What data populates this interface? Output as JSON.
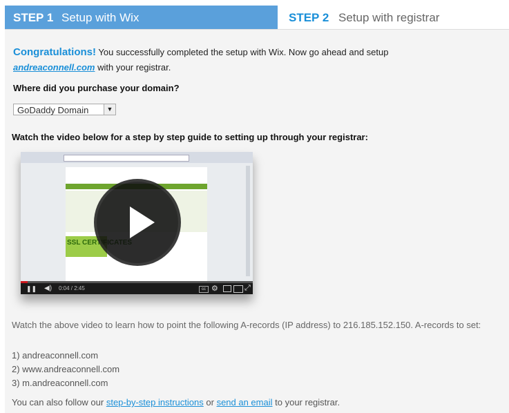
{
  "steps": [
    {
      "number": "STEP 1",
      "label": "Setup with Wix"
    },
    {
      "number": "STEP 2",
      "label": "Setup with registrar"
    }
  ],
  "congrats": {
    "heading": "Congratulations!",
    "text_before": "You successfully completed the setup with Wix. Now go ahead and setup",
    "domain": "andreaconnell.com",
    "text_after": "with your registrar."
  },
  "question": "Where did you purchase your domain?",
  "registrar_select": {
    "value": "GoDaddy Domain"
  },
  "watch_text": "Watch the video below for a step by step guide to setting up through your registrar:",
  "video": {
    "time": "0:04 / 2:45",
    "progress": 0.03,
    "site_label": "SSL CERTIFICATES"
  },
  "instructions": "Watch the above video to learn how to point the following A-records (IP address) to 216.185.152.150. A-records to set:",
  "a_records": [
    "1) andreaconnell.com",
    "2) www.andreaconnell.com",
    "3) m.andreaconnell.com"
  ],
  "footer": {
    "prefix": "You can also follow our",
    "link1": "step-by-step instructions",
    "middle": "or",
    "link2": "send an email",
    "suffix": "to your registrar."
  },
  "colors": {
    "accent": "#1a8fd8",
    "active_tab": "#5aa0db",
    "panel_bg": "#f4f4f4"
  }
}
